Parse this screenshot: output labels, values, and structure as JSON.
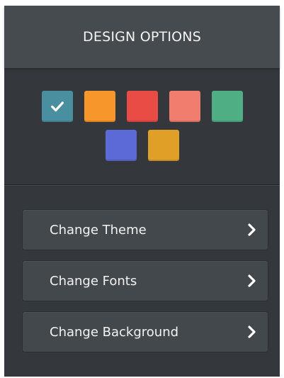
{
  "header": {
    "title": "DESIGN OPTIONS"
  },
  "swatches": [
    {
      "color": "#4a8fa0",
      "selected": true
    },
    {
      "color": "#f7962b"
    },
    {
      "color": "#e84c45"
    },
    {
      "color": "#f07d6e"
    },
    {
      "color": "#4fae84"
    },
    {
      "color": "#5b6ad6"
    },
    {
      "color": "#e0a028"
    }
  ],
  "menu": {
    "items": [
      {
        "label": "Change Theme",
        "icon": "chevron-right-icon"
      },
      {
        "label": "Change Fonts",
        "icon": "chevron-right-icon"
      },
      {
        "label": "Change Background",
        "icon": "chevron-right-icon"
      }
    ]
  }
}
